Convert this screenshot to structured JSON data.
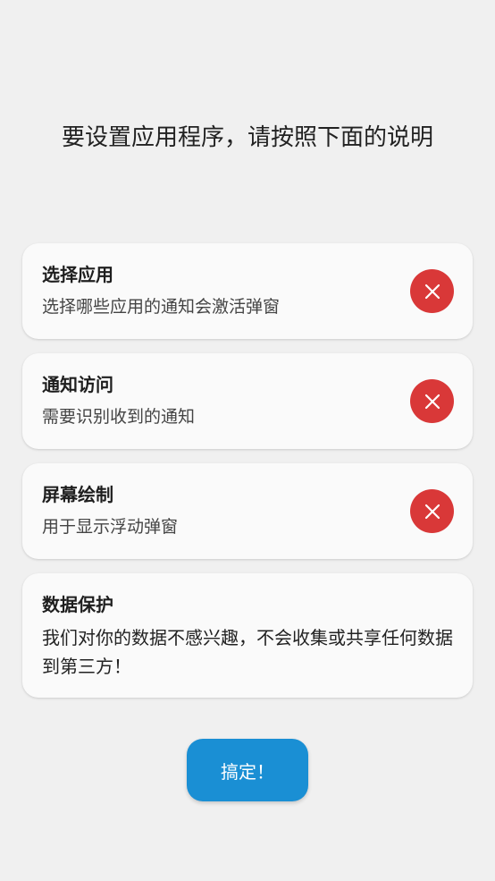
{
  "headline": "要设置应用程序，请按照下面的说明",
  "permissions": [
    {
      "title": "选择应用",
      "description": "选择哪些应用的通知会激活弹窗",
      "status_icon": "close-icon"
    },
    {
      "title": "通知访问",
      "description": "需要识别收到的通知",
      "status_icon": "close-icon"
    },
    {
      "title": "屏幕绘制",
      "description": "用于显示浮动弹窗",
      "status_icon": "close-icon"
    }
  ],
  "privacy": {
    "title": "数据保护",
    "description": "我们对你的数据不感兴趣，不会收集或共享任何数据到第三方！"
  },
  "done_label": "搞定！",
  "colors": {
    "background": "#f0f0f0",
    "card": "#fafafa",
    "status_error": "#d93838",
    "primary_button": "#1a8fd4"
  }
}
